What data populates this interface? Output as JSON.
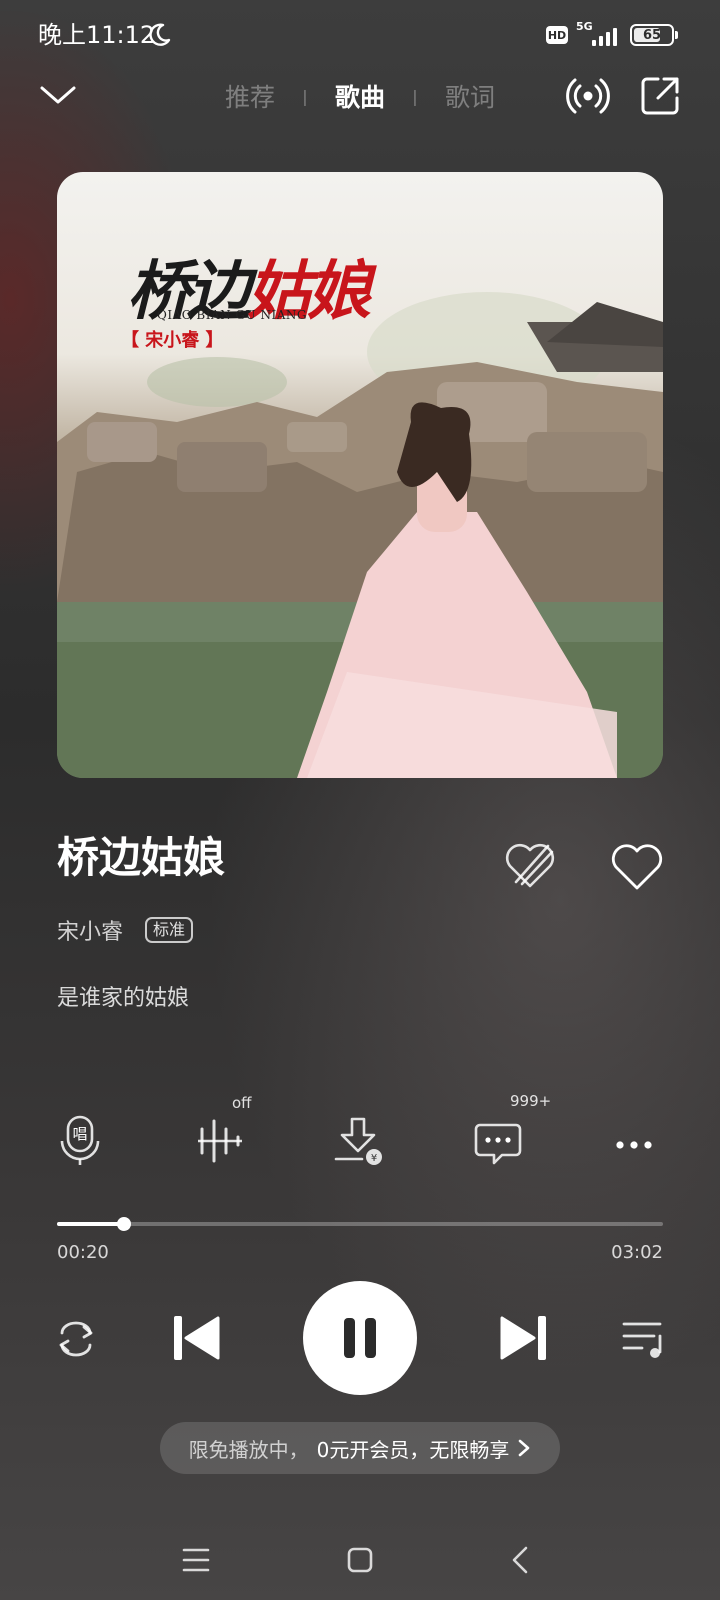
{
  "status_bar": {
    "time": "晚上11:12",
    "network": "5G",
    "hd": "HD",
    "battery": "65",
    "icons": [
      "moon-icon",
      "hd-icon",
      "signal-icon",
      "battery-icon"
    ]
  },
  "header": {
    "tabs": [
      {
        "label": "推荐",
        "active": false
      },
      {
        "label": "歌曲",
        "active": true
      },
      {
        "label": "歌词",
        "active": false
      }
    ],
    "icons": [
      "chevron-down-icon",
      "cast-icon",
      "share-icon"
    ]
  },
  "album_art": {
    "title_part1": "桥边",
    "title_part2": "姑娘",
    "pinyin": "QIAO BIAN GU NIANG",
    "artist_tag": "【 宋小睿 】"
  },
  "song": {
    "title": "桥边姑娘",
    "artist": "宋小睿",
    "quality": "标准",
    "current_lyric": "是谁家的姑娘"
  },
  "actions": {
    "sing_icon_label": "唱",
    "effect_badge": "off",
    "comments_badge": "999+",
    "icons": [
      "sing-icon",
      "sound-effect-icon",
      "download-icon",
      "comment-icon",
      "more-icon"
    ]
  },
  "progress": {
    "current": "00:20",
    "total": "03:02",
    "fraction": 0.11
  },
  "controls": {
    "icons": [
      "repeat-icon",
      "previous-icon",
      "pause-icon",
      "next-icon",
      "playlist-icon"
    ]
  },
  "promo": {
    "text_a": "限免播放中，",
    "text_b": "0元开会员，无限畅享"
  },
  "colors": {
    "accent_red": "#c8151b",
    "background": "#3a3a3a"
  }
}
